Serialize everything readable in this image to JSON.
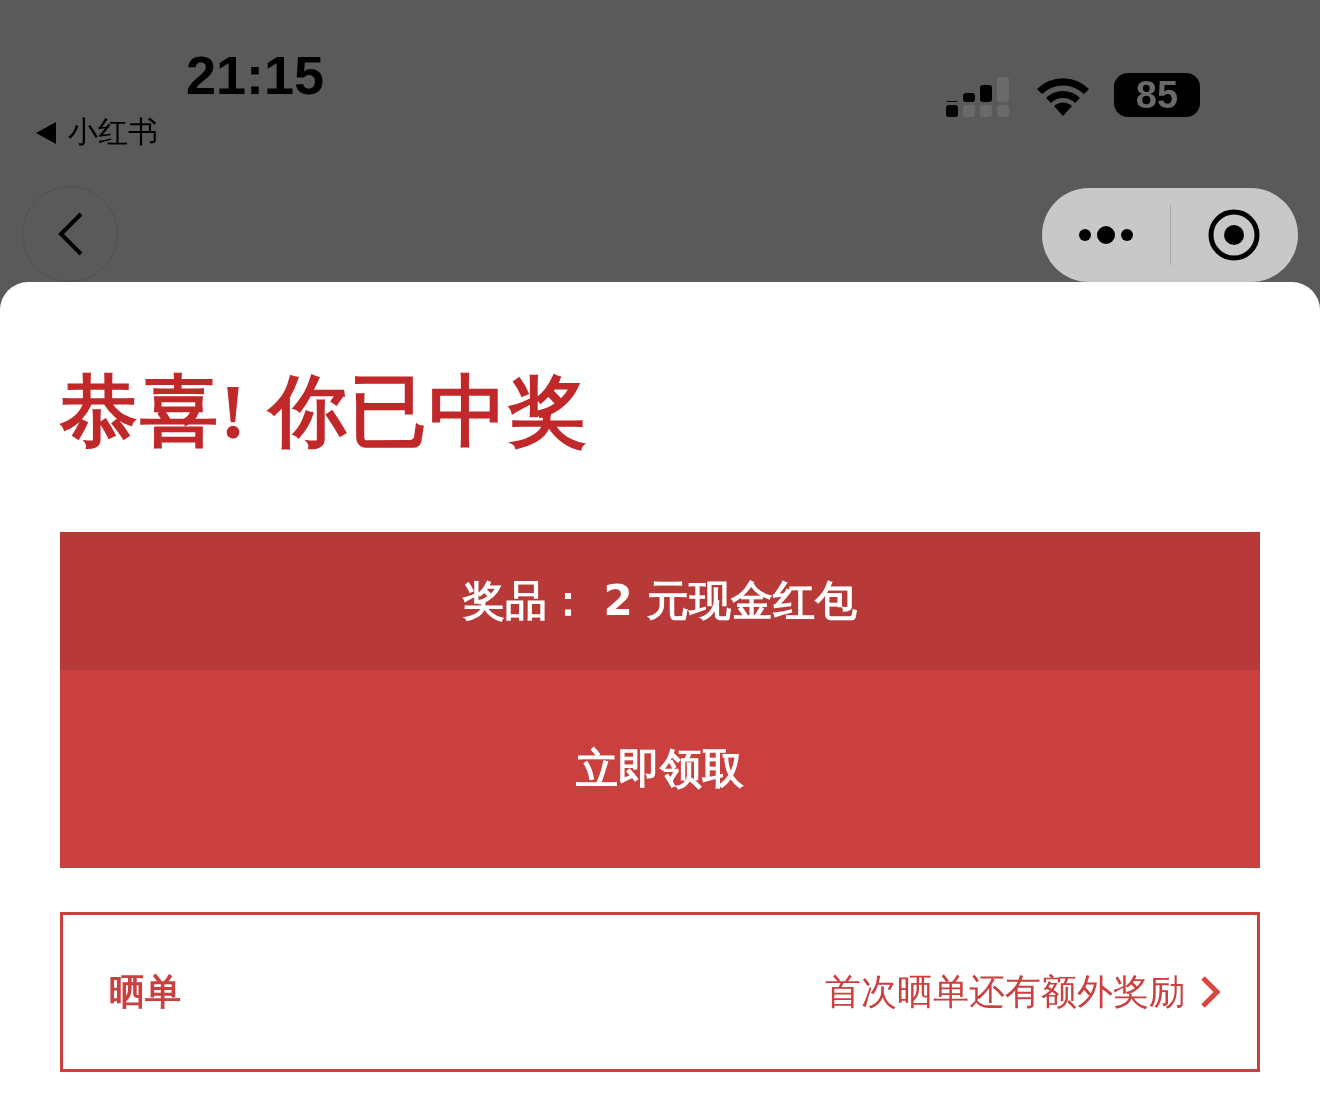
{
  "status_bar": {
    "time": "21:15",
    "back_app": "小红书",
    "battery": "85"
  },
  "title": "恭喜! 你已中奖",
  "prize": "奖品： 2 元现金红包",
  "claim_button": "立即领取",
  "share": {
    "label": "晒单",
    "hint": "首次晒单还有额外奖励"
  }
}
